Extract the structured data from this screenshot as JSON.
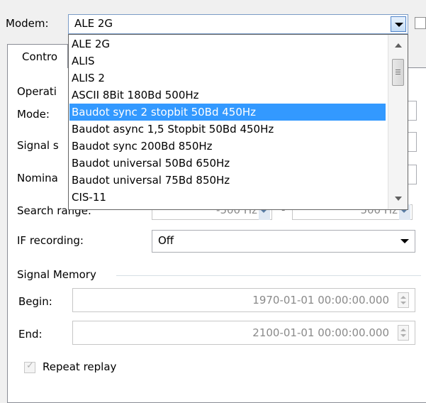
{
  "modem": {
    "label": "Modem:",
    "selected": "ALE 2G",
    "options": [
      "ALE 2G",
      "ALIS",
      "ALIS 2",
      "ASCII 8Bit 180Bd 500Hz",
      "Baudot sync 2 stopbit 50Bd 450Hz",
      "Baudot async 1,5 Stopbit 50Bd 450Hz",
      "Baudot sync 200Bd 850Hz",
      "Baudot universal 50Bd 650Hz",
      "Baudot universal 75Bd 850Hz",
      "CIS-11"
    ],
    "highlighted_index": 4
  },
  "tabs": [
    {
      "label": "Contro"
    }
  ],
  "operation": {
    "group_label": "Operati",
    "mode_label": "Mode:",
    "signal_label": "Signal s",
    "nominal_label": "Nomina",
    "search_label": "Search range:",
    "search_from": "-500 Hz",
    "search_to": "500 Hz",
    "search_separator": "-"
  },
  "if_recording": {
    "label": "IF recording:",
    "value": "Off"
  },
  "signal_memory": {
    "group_label": "Signal Memory",
    "begin_label": "Begin:",
    "begin_value": "1970-01-01 00:00:00.000",
    "end_label": "End:",
    "end_value": "2100-01-01 00:00:00.000",
    "repeat_label": "Repeat replay",
    "repeat_checked": true
  }
}
